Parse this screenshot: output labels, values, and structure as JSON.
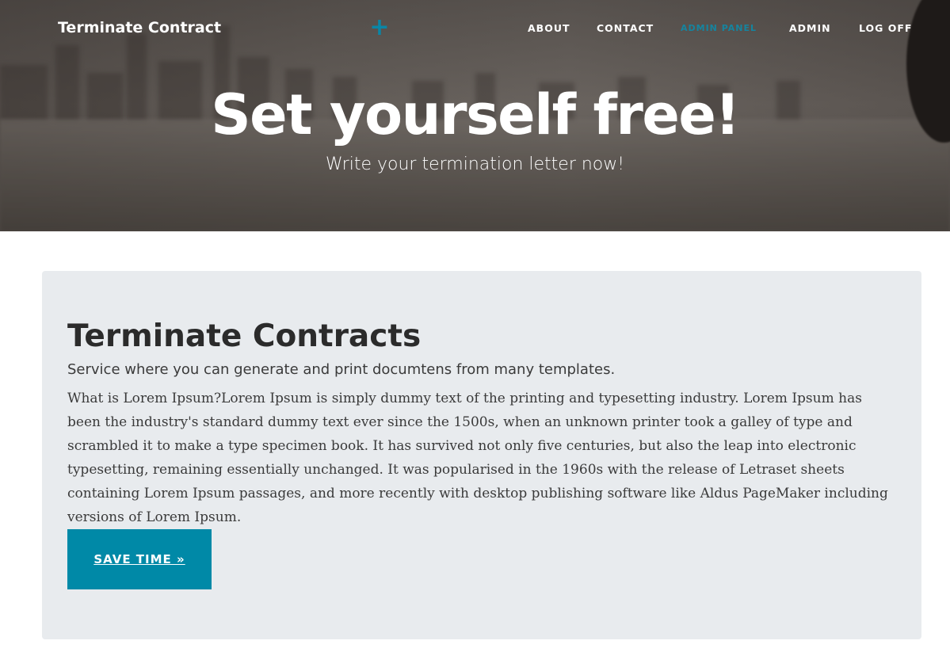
{
  "header": {
    "brand": "Terminate Contract",
    "nav": [
      {
        "label": "ABOUT"
      },
      {
        "label": "CONTACT"
      },
      {
        "label": "ADMIN PANEL"
      },
      {
        "label": "ADMIN"
      },
      {
        "label": "LOG OFF"
      }
    ]
  },
  "hero": {
    "title": "Set yourself free!",
    "subtitle": "Write your termination letter now!"
  },
  "main": {
    "title": "Terminate Contracts",
    "lead": "Service where you can generate and print documtens from many templates.",
    "body": "What is Lorem Ipsum?Lorem Ipsum is simply dummy text of the printing and typesetting industry. Lorem Ipsum has been the industry's standard dummy text ever since the 1500s, when an unknown printer took a galley of type and scrambled it to make a type specimen book. It has survived not only five centuries, but also the leap into electronic typesetting, remaining essentially unchanged. It was popularised in the 1960s with the release of Letraset sheets containing Lorem Ipsum passages, and more recently with desktop publishing software like Aldus PageMaker including versions of Lorem Ipsum.",
    "button_label": "SAVE TIME »"
  },
  "colors": {
    "accent": "#0089a7",
    "jumbotron_bg": "#e8ebee",
    "heading_text": "#2b2b2b"
  },
  "icons": {
    "center_icon": "plus-icon"
  }
}
